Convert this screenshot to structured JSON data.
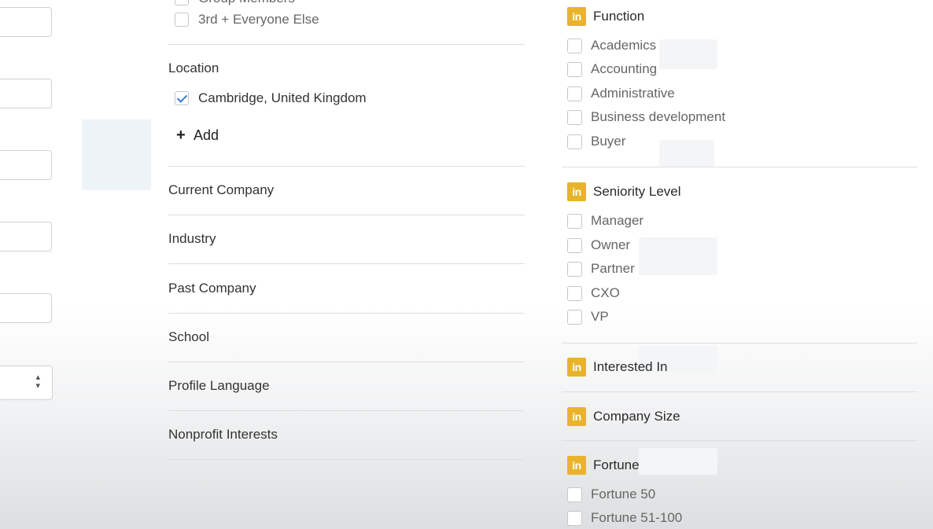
{
  "left_form": {
    "select_arrows": "⌃⌄"
  },
  "middle": {
    "partial_top_item": "Group Members",
    "connections": [
      {
        "label": "3rd + Everyone Else",
        "checked": false
      }
    ],
    "location": {
      "heading": "Location",
      "items": [
        {
          "label": "Cambridge, United Kingdom",
          "checked": true
        }
      ],
      "add_label": "Add"
    },
    "sections": [
      "Current Company",
      "Industry",
      "Past Company",
      "School",
      "Profile Language",
      "Nonprofit Interests"
    ]
  },
  "right": {
    "badge_text": "in",
    "function": {
      "heading": "Function",
      "items": [
        "Academics",
        "Accounting",
        "Administrative",
        "Business development",
        "Buyer"
      ]
    },
    "seniority": {
      "heading": "Seniority Level",
      "items": [
        "Manager",
        "Owner",
        "Partner",
        "CXO",
        "VP"
      ]
    },
    "interested_in": {
      "heading": "Interested In"
    },
    "company_size": {
      "heading": "Company Size"
    },
    "fortune": {
      "heading": "Fortune",
      "items": [
        "Fortune 50",
        "Fortune 51-100"
      ]
    }
  },
  "colors": {
    "premium_badge": "#e9b42a",
    "checkmark": "#3a7bd5"
  }
}
